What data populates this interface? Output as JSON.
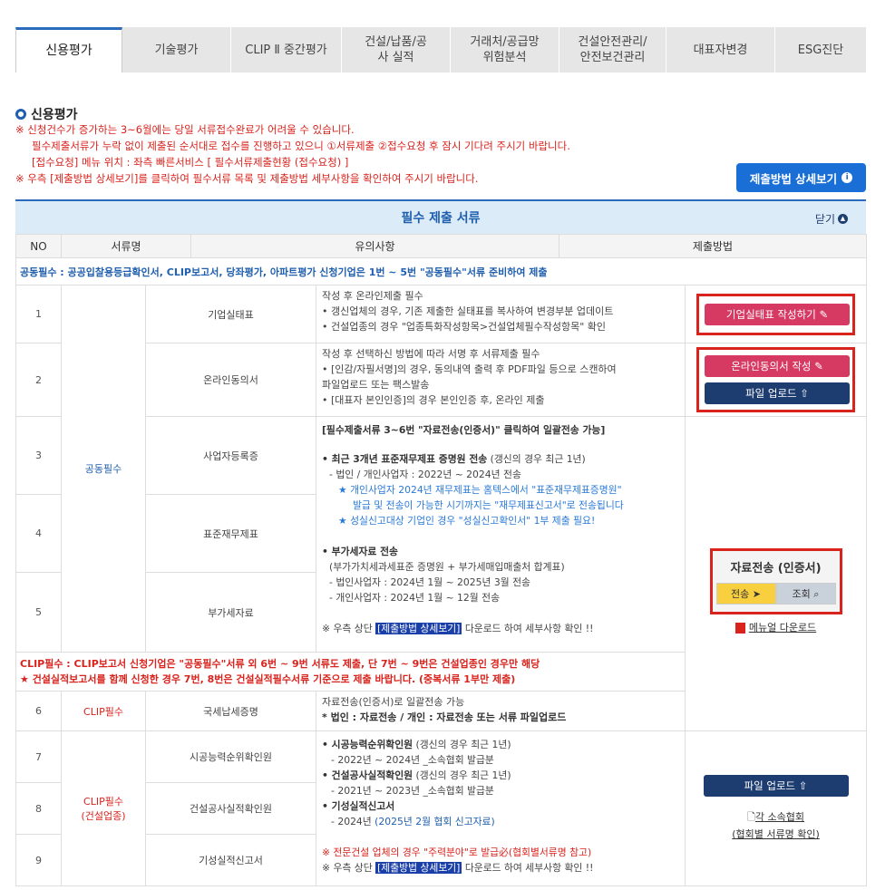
{
  "tabs": [
    {
      "label": "신용평가",
      "active": true
    },
    {
      "label": "기술평가"
    },
    {
      "label": "CLIP Ⅱ 중간평가"
    },
    {
      "label": "건설/납품/공사 실적"
    },
    {
      "label": "거래처/공급망 위험분석"
    },
    {
      "label": "건설안전관리/ 안전보건관리"
    },
    {
      "label": "대표자변경"
    },
    {
      "label": "ESG진단"
    }
  ],
  "section_title": "신용평가",
  "notes": [
    "※ 신청건수가 증가하는 3~6월에는 당일 서류접수완료가 어려울 수 있습니다.",
    "필수제출서류가 누락 없이 제출된 순서대로 접수를 진행하고 있으니 ①서류제출 ②접수요청 후 잠시 기다려 주시기 바랍니다.",
    "[접수요청] 메뉴 위치 : 좌측 빠른서비스 [ 필수서류제출현황 (접수요청) ]",
    "※ 우측 [제출방법 상세보기]를 클릭하여 필수서류 목록 및 제출방법 세부사항을 확인하여 주시기 바랍니다."
  ],
  "detail_button": "제출방법 상세보기",
  "table": {
    "title": "필수 제출 서류",
    "close": "닫기",
    "headers": [
      "NO",
      "서류명",
      "유의사항",
      "제출방법"
    ],
    "common_info": "공동필수 : 공공입찰용등급확인서, CLIP보고서, 당좌평가, 아파트평가 신청기업은 1번 ~ 5번 \"공동필수\"서류 준비하여 제출",
    "common_label": "공동필수",
    "rows": [
      {
        "no": "1",
        "name": "기업실태표",
        "memo": [
          "작성 후 온라인제출 필수",
          "• 갱신업체의 경우, 기존 제출한 실태표를 복사하여 변경부분 업데이트",
          "• 건설업종의 경우 \"업종특화작성항목>건설업체필수작성항목\" 확인"
        ]
      },
      {
        "no": "2",
        "name": "온라인동의서",
        "memo": [
          "작성 후 선택하신 방법에 따라 서명 후 서류제출 필수",
          "• [인감/자필서명]의 경우, 동의내역 출력 후 PDF파일 등으로 스캔하여",
          "파일업로드 또는 팩스발송",
          "• [대표자 본인인증]의 경우 본인인증 후, 온라인 제출"
        ]
      },
      {
        "no": "3",
        "name": "사업자등록증"
      },
      {
        "no": "4",
        "name": "표준재무제표"
      },
      {
        "no": "5",
        "name": "부가세자료"
      }
    ],
    "memo_3_5": {
      "l1": "[필수제출서류 3~6번 \"자료전송(인증서)\" 클릭하여 일괄전송 가능]",
      "l2": "• 최근 3개년 표준재무제표 증명원 전송",
      "l2b": " (갱신의 경우 최근 1년)",
      "l3": "- 법인 / 개인사업자 : 2022년 ~ 2024년 전송",
      "l4": "★ 개인사업자 2024년 재무제표는 홈텍스에서 \"표준재무제표증명원\"",
      "l5": "발급 및 전송이 가능한 시기까지는 \"재무제표신고서\"로 전송됩니다",
      "l6": "★ 성실신고대상 기업인 경우 \"성실신고확인서\" 1부 제출 필요!",
      "l7": "• 부가세자료 전송",
      "l8": "(부가가치세과세표준 증명원 + 부가세매입매출처 합계표)",
      "l9": "- 법인사업자 : 2024년 1월 ~ 2025년 3월 전송",
      "l10": "- 개인사업자 : 2024년 1월 ~ 12월 전송",
      "l11a": "※ 우측 상단 ",
      "l11b": "[제출방법 상세보기]",
      "l11c": " 다운로드 하여 세부사항 확인 !!"
    },
    "clip_info_1": "CLIP필수 : CLIP보고서 신청기업은 \"공동필수\"서류 외 6번 ~ 9번 서류도 제출, 단 7번 ~ 9번은 건설업종인 경우만 해당",
    "clip_info_2": "★ 건설실적보고서를 함께 신청한 경우 7번, 8번은 건설실적필수서류 기준으로 제출 바랍니다. (중복서류 1부만 제출)",
    "row6": {
      "no": "6",
      "group": "CLIP필수",
      "name": "국세납세증명",
      "memo1": "자료전송(인증서)로 일괄전송 가능",
      "memo2": "* 법인 : 자료전송 / 개인 : 자료전송 또는 서류 파일업로드"
    },
    "clip_group_1": "CLIP필수",
    "clip_group_2": "(건설업종)",
    "rows_clip": [
      {
        "no": "7",
        "name": "시공능력순위확인원"
      },
      {
        "no": "8",
        "name": "건설공사실적확인원"
      },
      {
        "no": "9",
        "name": "기성실적신고서"
      }
    ],
    "memo_7_9": {
      "a1": "• 시공능력순위확인원",
      "a1b": " (갱신의 경우 최근 1년)",
      "a2": "- 2022년 ~ 2024년 _소속협회 발급분",
      "b1": "• 건설공사실적확인원",
      "b1b": " (갱신의 경우 최근 1년)",
      "b2": "- 2021년 ~ 2023년 _소속협회 발급분",
      "c1": "• 기성실적신고서",
      "c2": "- 2024년 ",
      "c2b": "(2025년 2월 협회 신고자료)",
      "d1": "※ 전문건설 업체의 경우 \"주력분야\"로 발급必(협회별서류명 참고)",
      "e1": "※ 우측 상단 ",
      "e2": "[제출방법 상세보기]",
      "e3": " 다운로드 하여 세부사항 확인 !!"
    },
    "btn_company": "기업실태표 작성하기",
    "btn_consent": "온라인동의서 작성",
    "btn_upload": "파일 업로드",
    "trans_title": "자료전송 (인증서)",
    "btn_send": "전송",
    "btn_search": "조회",
    "manual_link": "메뉴얼 다운로드",
    "assoc_1": "각 소속협회",
    "assoc_2": "(협회별 서류명 확인)"
  },
  "colors": {
    "accent": "#1a6fd6",
    "navy": "#1d3c70",
    "pink": "#d63a63",
    "red": "#d9231d"
  }
}
